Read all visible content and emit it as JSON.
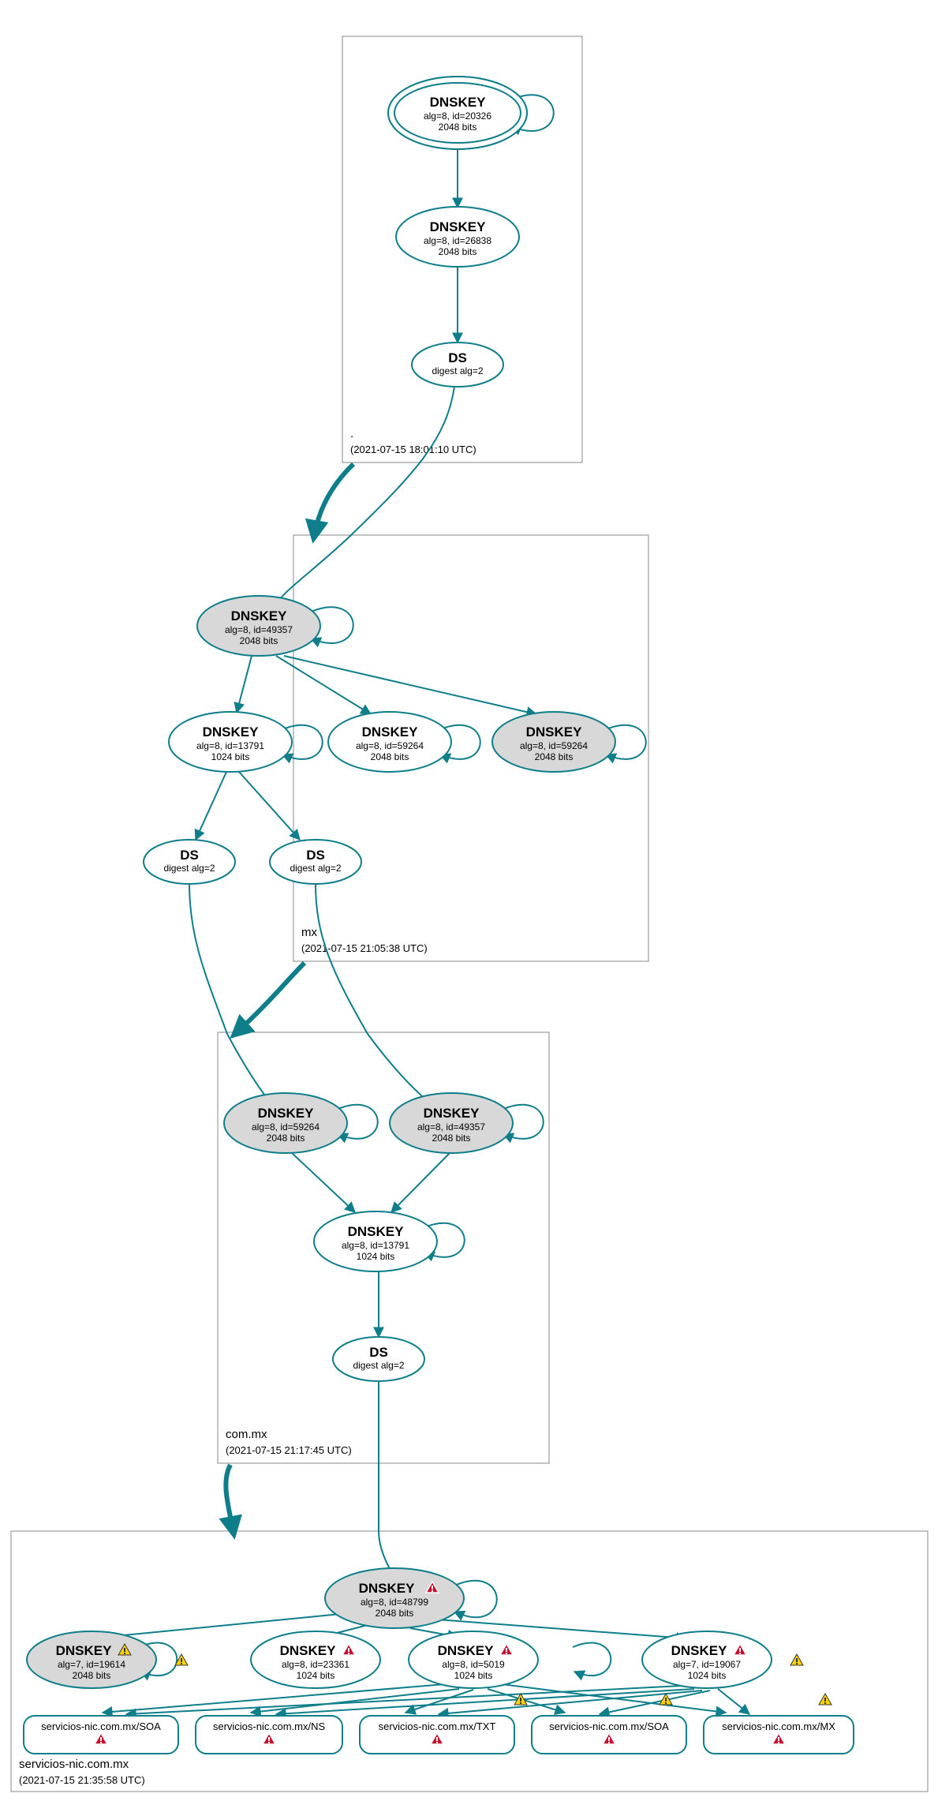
{
  "zones": {
    "root": {
      "label": ".",
      "timestamp": "(2021-07-15 18:01:10 UTC)"
    },
    "mx": {
      "label": "mx",
      "timestamp": "(2021-07-15 21:05:38 UTC)"
    },
    "commx": {
      "label": "com.mx",
      "timestamp": "(2021-07-15 21:17:45 UTC)"
    },
    "servicios": {
      "label": "servicios-nic.com.mx",
      "timestamp": "(2021-07-15 21:35:58 UTC)"
    }
  },
  "icons": {
    "warn": "⚠",
    "err": "⚠"
  },
  "nodes": {
    "n1": {
      "title": "DNSKEY",
      "l1": "alg=8, id=20326",
      "l2": "2048 bits"
    },
    "n2": {
      "title": "DNSKEY",
      "l1": "alg=8, id=26838",
      "l2": "2048 bits"
    },
    "n3": {
      "title": "DS",
      "l1": "digest alg=2",
      "l2": ""
    },
    "n4": {
      "title": "DNSKEY",
      "l1": "alg=8, id=49357",
      "l2": "2048 bits"
    },
    "n5": {
      "title": "DNSKEY",
      "l1": "alg=8, id=13791",
      "l2": "1024 bits"
    },
    "n6": {
      "title": "DNSKEY",
      "l1": "alg=8, id=59264",
      "l2": "2048 bits"
    },
    "n7": {
      "title": "DS",
      "l1": "digest alg=2",
      "l2": ""
    },
    "n8": {
      "title": "DS",
      "l1": "digest alg=2",
      "l2": ""
    },
    "n9": {
      "title": "DNSKEY",
      "l1": "alg=8, id=59264",
      "l2": "2048 bits"
    },
    "n10": {
      "title": "DNSKEY",
      "l1": "alg=8, id=49357",
      "l2": "2048 bits"
    },
    "n11": {
      "title": "DNSKEY",
      "l1": "alg=8, id=13791",
      "l2": "1024 bits"
    },
    "n12": {
      "title": "DS",
      "l1": "digest alg=2",
      "l2": ""
    },
    "n13": {
      "title": "DNSKEY",
      "l1": "alg=8, id=48799",
      "l2": "2048 bits",
      "status": "err"
    },
    "n14": {
      "title": "DNSKEY",
      "l1": "alg=7, id=19614",
      "l2": "2048 bits",
      "status": "warn"
    },
    "n15": {
      "title": "DNSKEY",
      "l1": "alg=8, id=23361",
      "l2": "1024 bits",
      "status": "err"
    },
    "n16": {
      "title": "DNSKEY",
      "l1": "alg=8, id=5019",
      "l2": "1024 bits",
      "status": "err"
    },
    "n17": {
      "title": "DNSKEY",
      "l1": "alg=7, id=19067",
      "l2": "1024 bits",
      "status": "err"
    },
    "r1": {
      "title": "servicios-nic.com.mx/SOA",
      "status": "err"
    },
    "r2": {
      "title": "servicios-nic.com.mx/NS",
      "status": "err"
    },
    "r3": {
      "title": "servicios-nic.com.mx/TXT",
      "status": "err"
    },
    "r4": {
      "title": "servicios-nic.com.mx/SOA",
      "status": "err"
    },
    "r5": {
      "title": "servicios-nic.com.mx/MX",
      "status": "err"
    }
  }
}
